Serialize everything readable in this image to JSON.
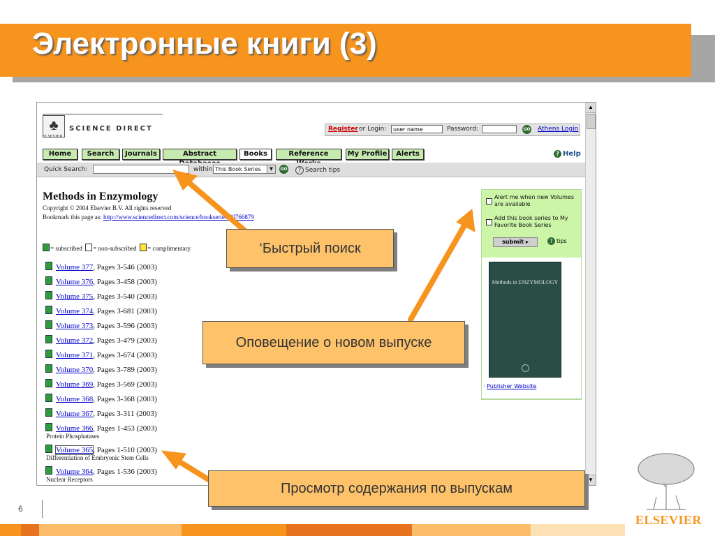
{
  "slide": {
    "title": "Электронные книги (3)",
    "page_number": "6"
  },
  "site": {
    "wordmark": "SCIENCE DIRECT",
    "logo_small_text": "ELSEVIER",
    "login": {
      "register": "Register",
      "or_login": "or Login:",
      "username_value": "user name",
      "password_label": "Password:",
      "go": "GO",
      "athens": "Athens Login"
    },
    "nav": [
      "Home",
      "Search",
      "Journals",
      "Abstract Databases",
      "Books",
      "Reference Works",
      "My Profile",
      "Alerts"
    ],
    "active_nav": "Books",
    "help": "Help",
    "quick_search": {
      "label": "Quick Search:",
      "within": "within",
      "scope": "This Book Series",
      "go": "GO",
      "tips": "Search tips"
    }
  },
  "book": {
    "title": "Methods in Enzymology",
    "copyright": "Copyright © 2004 Elsevier B.V. All rights reserved",
    "bookmark_label": "Bookmark this page as:",
    "bookmark_url": "http://www.sciencedirect.com/science/bookseries/00766879"
  },
  "legend": {
    "subscribed": "= subscribed",
    "non_subscribed": "= non-subscribed",
    "complimentary": "= complimentary"
  },
  "volumes": [
    {
      "label": "Volume 377",
      "pages": ", Pages 3-546 (2003)",
      "subtitle": ""
    },
    {
      "label": "Volume 376",
      "pages": ", Pages 3-458 (2003)",
      "subtitle": ""
    },
    {
      "label": "Volume 375",
      "pages": ", Pages 3-540 (2003)",
      "subtitle": ""
    },
    {
      "label": "Volume 374",
      "pages": ", Pages 3-681 (2003)",
      "subtitle": ""
    },
    {
      "label": "Volume 373",
      "pages": ", Pages 3-596 (2003)",
      "subtitle": ""
    },
    {
      "label": "Volume 372",
      "pages": ", Pages 3-479 (2003)",
      "subtitle": ""
    },
    {
      "label": "Volume 371",
      "pages": ", Pages 3-674 (2003)",
      "subtitle": ""
    },
    {
      "label": "Volume 370",
      "pages": ", Pages 3-789 (2003)",
      "subtitle": ""
    },
    {
      "label": "Volume 369",
      "pages": ", Pages 3-569 (2003)",
      "subtitle": ""
    },
    {
      "label": "Volume 368",
      "pages": ", Pages 3-368 (2003)",
      "subtitle": ""
    },
    {
      "label": "Volume 367",
      "pages": ", Pages 3-311 (2003)",
      "subtitle": ""
    },
    {
      "label": "Volume 366",
      "pages": ", Pages 1-453 (2003)",
      "subtitle": "Protein Phosphatases"
    },
    {
      "label": "Volume 365",
      "pages": ", Pages 1-510 (2003)",
      "subtitle": "Differentiation of Embryonic Stem Cells"
    },
    {
      "label": "Volume 364",
      "pages": ", Pages 1-536 (2003)",
      "subtitle": "Nuclear Receptors"
    }
  ],
  "sidebar": {
    "alert_option": "Alert me when new Volumes are available",
    "favorite_option": "Add this book series to My Favorite Book Series",
    "submit": "submit ▸",
    "tips": "tips",
    "cover_title": "Methods in ENZYMOLOGY",
    "publisher_link": "Publisher Website"
  },
  "callouts": {
    "search": "‘Быстрый поиск",
    "notify": "Оповещение о новом выпуске",
    "browse": "Просмотр содержания по выпускам"
  },
  "branding": {
    "logo": "ELSEVIER",
    "accent": "#f7941d"
  }
}
